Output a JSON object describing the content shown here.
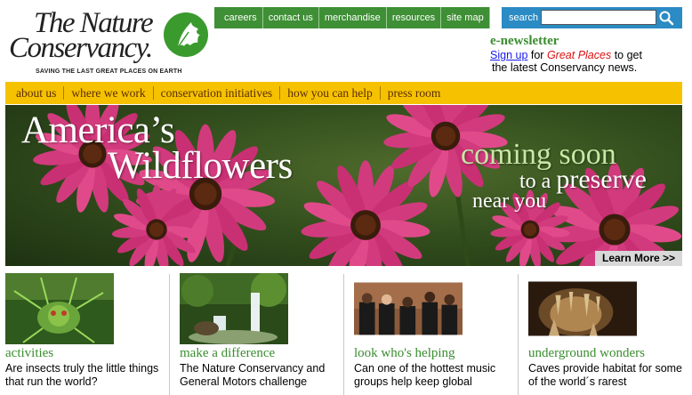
{
  "logo": {
    "line1": "The Nature",
    "line2": "Conservancy.",
    "tagline": "SAVING THE LAST GREAT PLACES ON EARTH"
  },
  "topnav": {
    "items": [
      "careers",
      "contact us",
      "merchandise",
      "resources",
      "site map"
    ]
  },
  "search": {
    "label": "search",
    "value": ""
  },
  "newsletter": {
    "title": "e-newsletter",
    "signup": "Sign up",
    "for": " for ",
    "great_places": "Great Places",
    "to_get": " to get",
    "line2": "the latest Conservancy news."
  },
  "mainnav": {
    "items": [
      "about us",
      "where we work",
      "conservation initiatives",
      "how you can help",
      "press room"
    ]
  },
  "hero": {
    "title_line1": "America’s",
    "title_line2": "Wildflowers",
    "coming": "coming soon",
    "to_a": "to a ",
    "preserve": "preserve",
    "near_you": "near you",
    "learn_more": "Learn More >>"
  },
  "features": [
    {
      "title": "activities",
      "desc": "Are insects truly the little things that run the world?"
    },
    {
      "title": "make a difference",
      "desc": "The Nature Conservancy and General Motors challenge"
    },
    {
      "title": "look who's helping",
      "desc": "Can one of the hottest music groups help keep global"
    },
    {
      "title": "underground wonders",
      "desc": "Caves provide habitat for some of the world´s rarest"
    }
  ],
  "colors": {
    "topnav_green": "#3e8f35",
    "search_blue": "#2b8bc4",
    "mainnav_yellow": "#f6c200",
    "title_green": "#3a8d2f",
    "great_places_red": "#dd1111"
  }
}
